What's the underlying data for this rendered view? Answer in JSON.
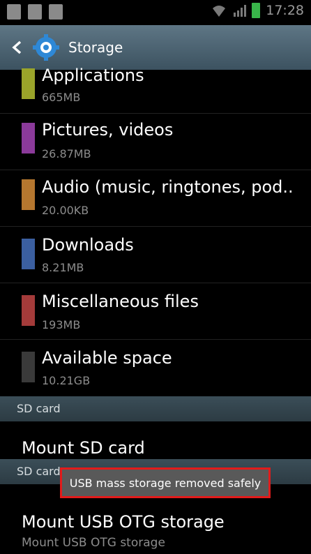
{
  "status_bar": {
    "time": "17:28",
    "icons": [
      "sd-card-icon",
      "usb-icon",
      "download-icon",
      "wifi-icon",
      "signal-icon",
      "battery-icon"
    ]
  },
  "header": {
    "title": "Storage",
    "back_icon": "chevron-left-icon",
    "app_icon": "gear-icon",
    "colors": {
      "bar_top": "#5e7685",
      "bar_bottom": "#3c5260"
    }
  },
  "categories": [
    {
      "label": "Applications",
      "size": "665MB",
      "color": "#9aa42a"
    },
    {
      "label": "Pictures, videos",
      "size": "26.87MB",
      "color": "#8b3a9a"
    },
    {
      "label": "Audio (music, ringtones, pod..",
      "size": "20.00KB",
      "color": "#b5772f"
    },
    {
      "label": "Downloads",
      "size": "8.21MB",
      "color": "#3b5fa0"
    },
    {
      "label": "Miscellaneous files",
      "size": "193MB",
      "color": "#a43b3a"
    },
    {
      "label": "Available space",
      "size": "10.21GB",
      "color": "#3a3a3a"
    }
  ],
  "sections": {
    "sd_card_1": "SD card",
    "sd_card_2": "SD card"
  },
  "actions": {
    "mount_sd": "Mount SD card",
    "mount_usb": "Mount USB OTG storage",
    "mount_usb_sub": "Mount USB OTG storage"
  },
  "toast": {
    "text": "USB mass storage removed safely",
    "highlight_color": "#e21b1b"
  }
}
